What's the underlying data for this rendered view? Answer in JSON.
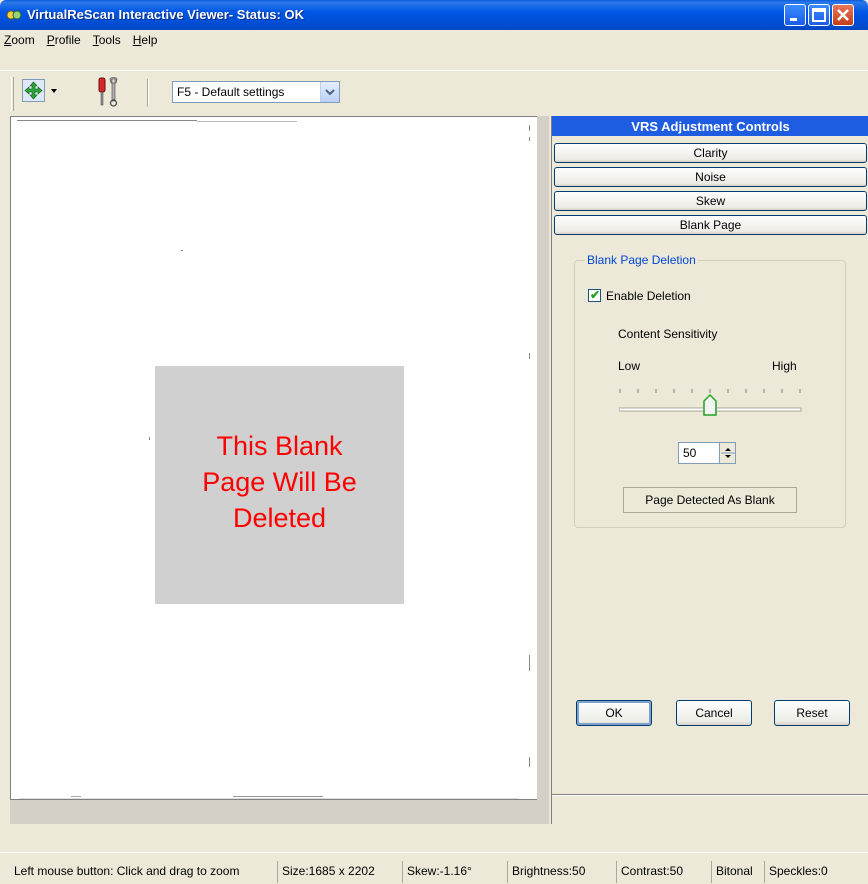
{
  "window": {
    "title": "VirtualReScan Interactive Viewer- Status: OK"
  },
  "menu": {
    "items": [
      {
        "label": "Zoom"
      },
      {
        "label": "Profile"
      },
      {
        "label": "Tools"
      },
      {
        "label": "Help"
      }
    ]
  },
  "toolbar": {
    "profile_selected": "F5 - Default settings"
  },
  "viewer": {
    "blank_marker_text": "This Blank\nPage Will Be\nDeleted"
  },
  "panel": {
    "header": "VRS Adjustment Controls",
    "sections": [
      {
        "label": "Clarity"
      },
      {
        "label": "Noise"
      },
      {
        "label": "Skew"
      },
      {
        "label": "Blank Page"
      }
    ],
    "group_title": "Blank Page Deletion",
    "enable_label": "Enable Deletion",
    "enable_checked": true,
    "sensitivity_label": "Content Sensitivity",
    "low_label": "Low",
    "high_label": "High",
    "sensitivity_value": "50",
    "slider_fraction": 0.5,
    "status_text": "Page Detected As Blank"
  },
  "buttons": {
    "ok": "OK",
    "cancel": "Cancel",
    "reset": "Reset"
  },
  "statusbar": {
    "hint": "Left mouse button: Click and drag to zoom",
    "size": "Size:1685 x 2202",
    "skew": "Skew:-1.16°",
    "brightness": "Brightness:50",
    "contrast": "Contrast:50",
    "mode": "Bitonal",
    "speckles": "Speckles:0"
  },
  "colors": {
    "title_bar": "#0055e5",
    "panel_header": "#1e5ce2",
    "blank_text": "#ff0000",
    "blank_marker_bg": "#d0d0d0"
  }
}
